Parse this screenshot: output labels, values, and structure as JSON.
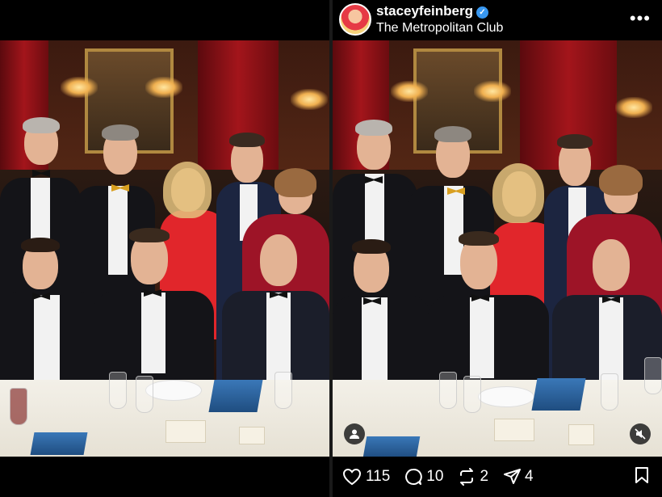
{
  "post": {
    "username": "staceyfeinberg",
    "location": "The Metropolitan Club",
    "more_label": "•••",
    "verified_icon": "✓"
  },
  "stats": {
    "likes": "115",
    "comments": "10",
    "reposts": "2",
    "shares": "4"
  },
  "colors": {
    "background": "#000000",
    "verified_blue": "#3897f0",
    "dress_red": "#e1262b"
  }
}
